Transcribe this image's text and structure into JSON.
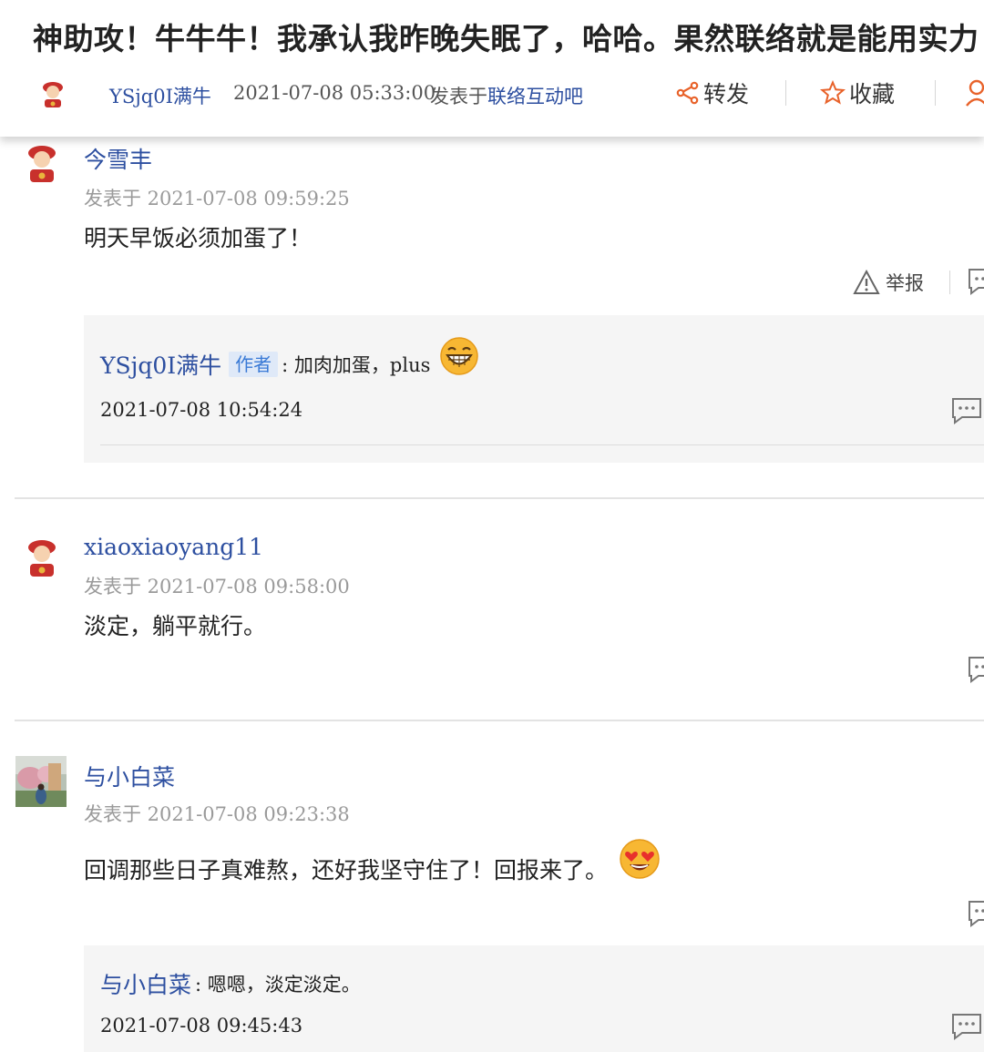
{
  "post": {
    "title": "神助攻！牛牛牛！我承认我昨晚失眠了，哈哈。果然联络就是能用实力",
    "author": "YSjq0I满牛",
    "time": "2021-07-08 05:33:00",
    "posted_in_prefix": "发表于",
    "forum": "联络互动吧",
    "share_label": "转发",
    "favorite_label": "收藏"
  },
  "comments": [
    {
      "user": "今雪丰",
      "time": "发表于 2021-07-08 09:59:25",
      "text": "明天早饭必须加蛋了！",
      "report_label": "举报",
      "replies": [
        {
          "user": "YSjq0I满牛",
          "tag": "作者",
          "text": ": 加肉加蛋，plus",
          "emoji": "grinning-emoji",
          "time": "2021-07-08 10:54:24"
        }
      ]
    },
    {
      "user": "xiaoxiaoyang11",
      "time": "发表于 2021-07-08 09:58:00",
      "text": "淡定，躺平就行。"
    },
    {
      "user": "与小白菜",
      "time": "发表于 2021-07-08 09:23:38",
      "text": "回调那些日子真难熬，还好我坚守住了！回报来了。",
      "emoji": "heart-eyes-emoji",
      "replies": [
        {
          "user": "与小白菜",
          "text": ": 嗯嗯，淡定淡定。",
          "time": "2021-07-08 09:45:43"
        }
      ]
    }
  ],
  "colors": {
    "link_blue": "#2d4fa0",
    "share_orange": "#e8622a",
    "tag_bg": "#dfe9f8",
    "tag_text": "#3a7ad6",
    "reply_bg": "#f5f5f5"
  }
}
